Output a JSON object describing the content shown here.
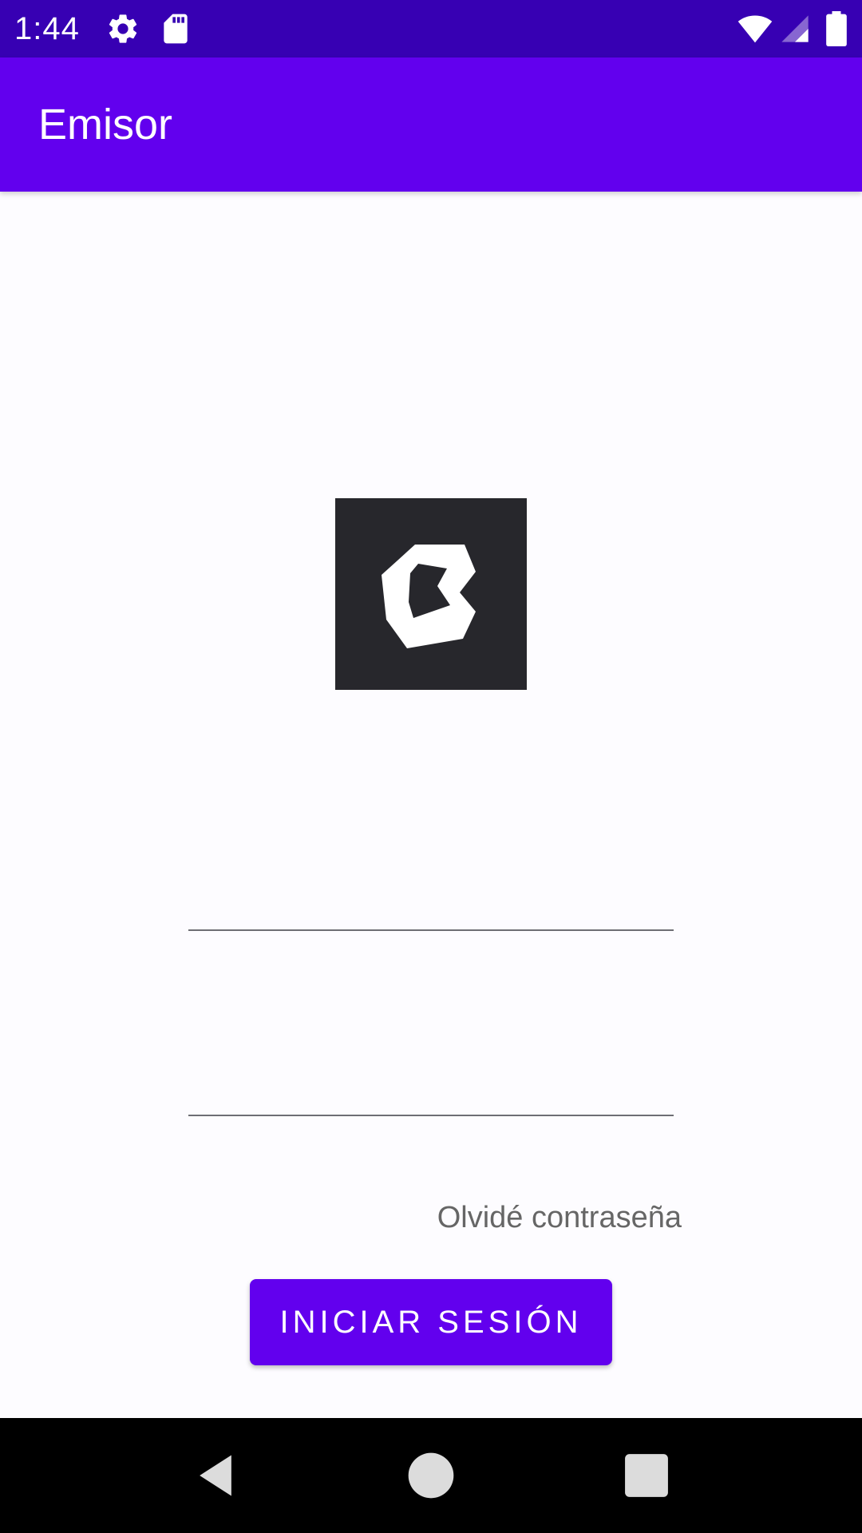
{
  "status_bar": {
    "time": "1:44",
    "icons": [
      "settings-icon",
      "sd-card-icon",
      "wifi-icon",
      "signal-icon",
      "battery-icon"
    ]
  },
  "app_bar": {
    "title": "Emisor"
  },
  "logo": {
    "name": "brand-logo",
    "background": "#27272c"
  },
  "form": {
    "username": {
      "value": "",
      "placeholder": ""
    },
    "password": {
      "value": "",
      "placeholder": ""
    },
    "forgot_password": "Olvidé contraseña",
    "login_button": "INICIAR SESIÓN"
  },
  "nav_bar": {
    "buttons": [
      "back-icon",
      "home-icon",
      "recents-icon"
    ]
  },
  "colors": {
    "status_bar": "#3700b3",
    "primary": "#6200ee",
    "background": "#fdfcff",
    "secondary_text": "#666666"
  }
}
